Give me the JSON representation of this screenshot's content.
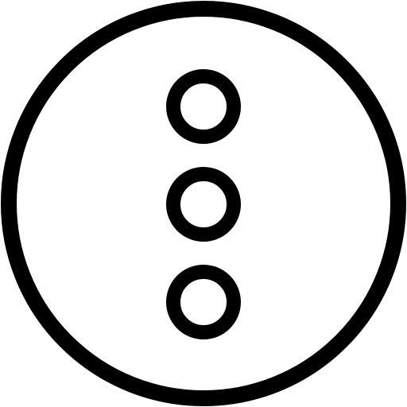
{
  "icon": {
    "name": "more-vertical-circle-icon",
    "stroke_color": "#000000",
    "background_color": "#ffffff"
  }
}
